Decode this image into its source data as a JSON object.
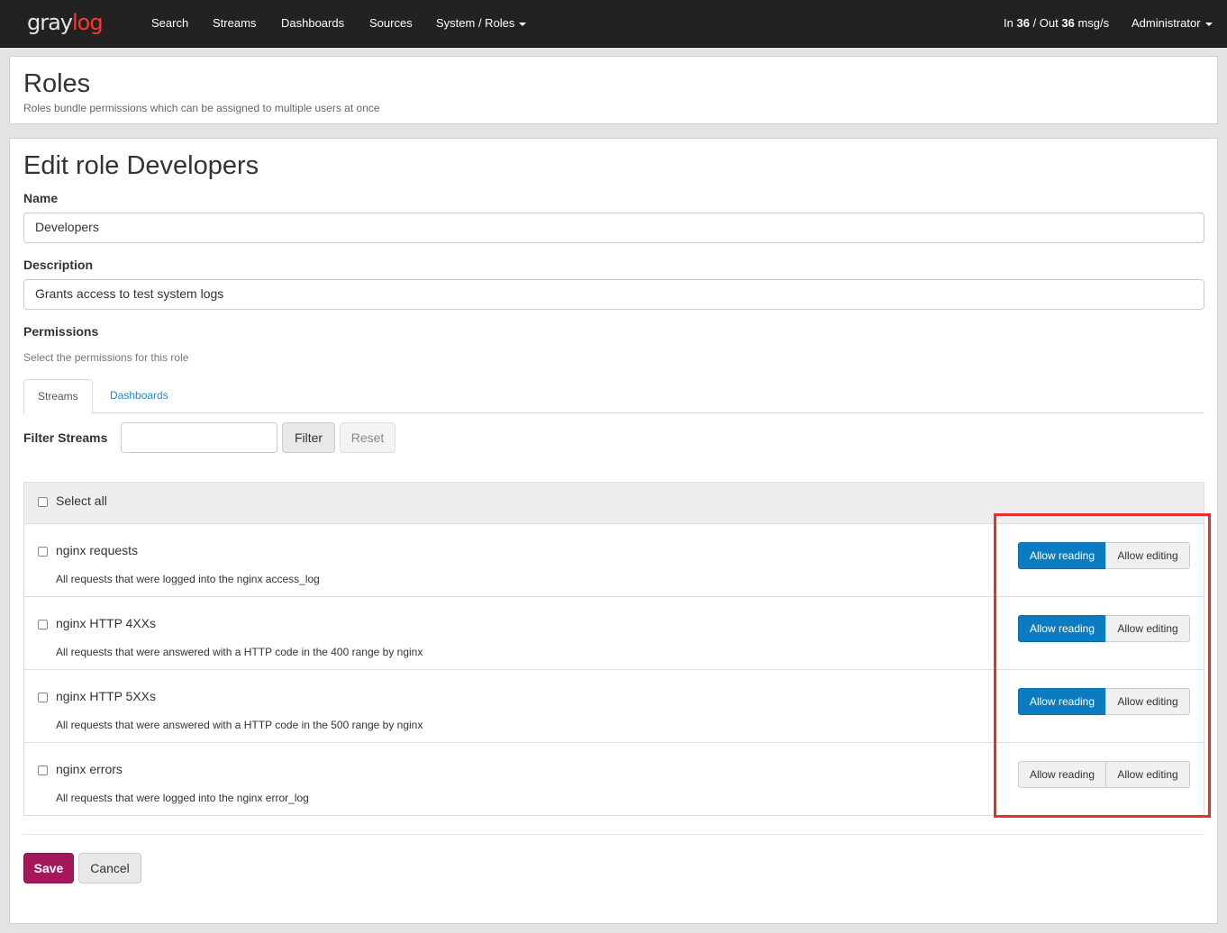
{
  "nav": {
    "logo_gray": "gray",
    "logo_log": "log",
    "items": [
      "Search",
      "Streams",
      "Dashboards",
      "Sources"
    ],
    "system_menu": "System / Roles",
    "throughput": {
      "in_label": "In",
      "in_value": "36",
      "sep": "/ Out",
      "out_value": "36",
      "unit": "msg/s"
    },
    "user": "Administrator"
  },
  "header": {
    "title": "Roles",
    "subtitle": "Roles bundle permissions which can be assigned to multiple users at once"
  },
  "form": {
    "title": "Edit role Developers",
    "name_label": "Name",
    "name_value": "Developers",
    "description_label": "Description",
    "description_value": "Grants access to test system logs",
    "permissions_label": "Permissions",
    "permissions_help": "Select the permissions for this role",
    "tabs": [
      "Streams",
      "Dashboards"
    ],
    "filter_label": "Filter Streams",
    "filter_button": "Filter",
    "reset_button": "Reset",
    "select_all": "Select all",
    "streams": [
      {
        "title": "nginx requests",
        "description": "All requests that were logged into the nginx access_log",
        "read": true,
        "edit": false
      },
      {
        "title": "nginx HTTP 4XXs",
        "description": "All requests that were answered with a HTTP code in the 400 range by nginx",
        "read": true,
        "edit": false
      },
      {
        "title": "nginx HTTP 5XXs",
        "description": "All requests that were answered with a HTTP code in the 500 range by nginx",
        "read": true,
        "edit": false
      },
      {
        "title": "nginx errors",
        "description": "All requests that were logged into the nginx error_log",
        "read": false,
        "edit": false
      }
    ],
    "allow_reading": "Allow reading",
    "allow_editing": "Allow editing",
    "save_button": "Save",
    "cancel_button": "Cancel"
  },
  "colors": {
    "navbar": "#222222",
    "primary": "#0b7cbf",
    "save": "#a5185b",
    "highlight": "#e8302a"
  }
}
